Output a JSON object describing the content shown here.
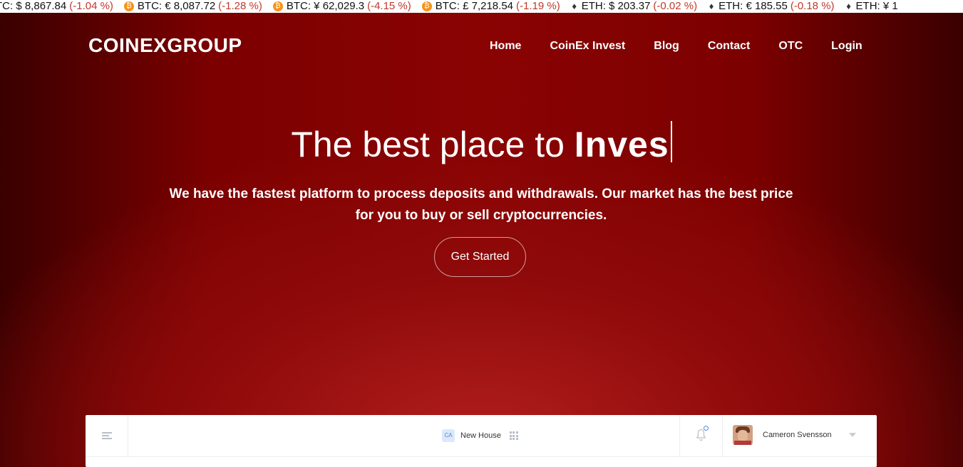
{
  "ticker": [
    {
      "coin": "btc",
      "label": "TC: $ 8,867.84",
      "change": "(-1.04 %)",
      "show_icon": false
    },
    {
      "coin": "btc",
      "label": "BTC: € 8,087.72",
      "change": "(-1.28 %)",
      "show_icon": true
    },
    {
      "coin": "btc",
      "label": "BTC: ¥ 62,029.3",
      "change": "(-4.15 %)",
      "show_icon": true
    },
    {
      "coin": "btc",
      "label": "BTC: £ 7,218.54",
      "change": "(-1.19 %)",
      "show_icon": true
    },
    {
      "coin": "eth",
      "label": "ETH: $ 203.37",
      "change": "(-0.02 %)",
      "show_icon": true
    },
    {
      "coin": "eth",
      "label": "ETH: € 185.55",
      "change": "(-0.18 %)",
      "show_icon": true
    },
    {
      "coin": "eth",
      "label": "ETH: ¥ 1",
      "change": "",
      "show_icon": true
    }
  ],
  "header": {
    "logo": "COINEXGROUP",
    "nav": [
      "Home",
      "CoinEx Invest",
      "Blog",
      "Contact",
      "OTC",
      "Login"
    ]
  },
  "hero": {
    "headline_plain": "The best place to ",
    "headline_strong": "Inves",
    "subtext": "We have the fastest platform to process deposits and withdrawals. Our market has the best price for you to buy or sell cryptocurrencies.",
    "cta": "Get Started"
  },
  "dashboard": {
    "badge": "CA",
    "house": "New House",
    "user": "Cameron Svensson"
  },
  "colors": {
    "brand_red": "#8a0303",
    "change_negative": "#c0392b",
    "btc_orange": "#f7931a"
  },
  "icons": [
    "bitcoin-icon",
    "ethereum-icon",
    "menu-icon",
    "grid-icon",
    "bell-icon",
    "chevron-down-icon"
  ]
}
